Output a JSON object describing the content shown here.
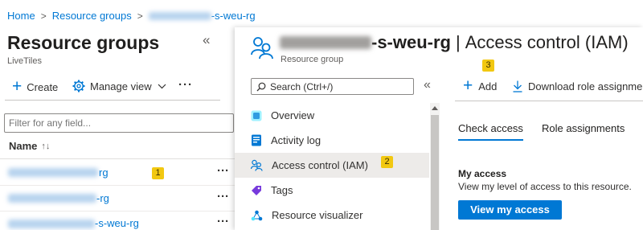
{
  "breadcrumb": {
    "home": "Home",
    "resource_groups": "Resource groups",
    "current_suffix": "-s-weu-rg"
  },
  "left": {
    "title": "Resource groups",
    "subtitle": "LiveTiles",
    "collapse": "«",
    "create": "Create",
    "manage_view": "Manage view",
    "more": "···",
    "filter_placeholder": "Filter for any field...",
    "col_name": "Name",
    "sort_icon": "↑↓",
    "rows": [
      {
        "suffix": "rg",
        "more": "···"
      },
      {
        "suffix": "-rg",
        "more": "···"
      },
      {
        "suffix": "-s-weu-rg",
        "more": "···"
      }
    ]
  },
  "middle": {
    "title_suffix": "-s-weu-rg",
    "title_sep": "|",
    "title_main": "Access control (IAM)",
    "subtitle": "Resource group",
    "search_placeholder": "Search (Ctrl+/)",
    "collapse": "«",
    "menu": [
      {
        "label": "Overview",
        "icon": "overview-icon"
      },
      {
        "label": "Activity log",
        "icon": "activity-log-icon"
      },
      {
        "label": "Access control (IAM)",
        "icon": "access-control-icon"
      },
      {
        "label": "Tags",
        "icon": "tag-icon"
      },
      {
        "label": "Resource visualizer",
        "icon": "resource-visualizer-icon"
      }
    ]
  },
  "right": {
    "add": "Add",
    "download": "Download role assignmen",
    "tabs": [
      "Check access",
      "Role assignments"
    ],
    "section_title": "My access",
    "section_desc": "View my level of access to this resource.",
    "view_button": "View my access"
  },
  "badges": [
    "1",
    "2",
    "3"
  ],
  "colors": {
    "accent": "#0078d4",
    "badge": "#f2c811",
    "selected_bg": "#edebe9"
  }
}
